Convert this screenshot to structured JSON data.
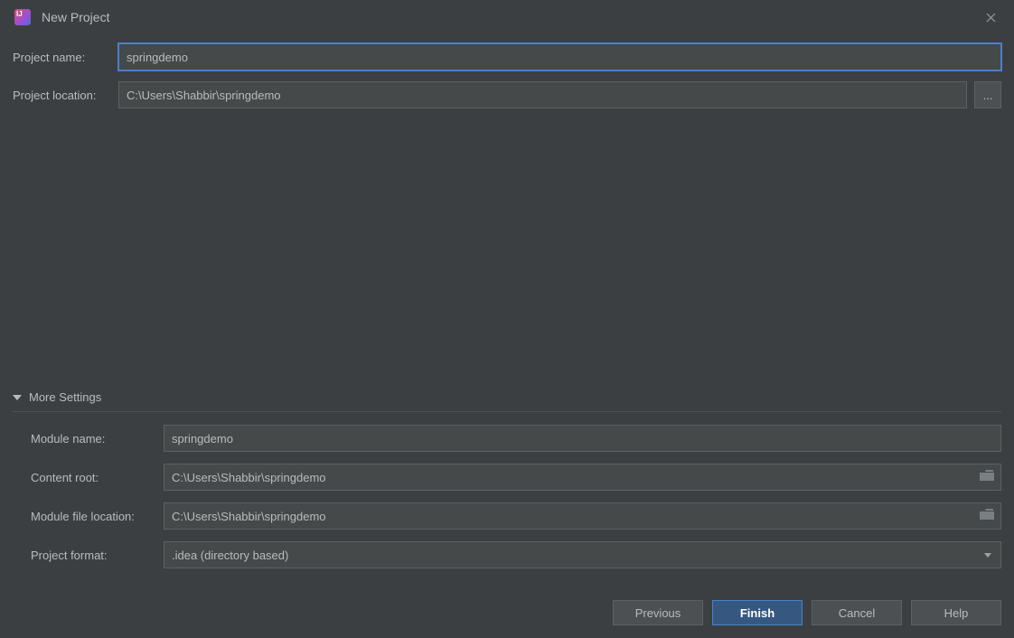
{
  "title": "New Project",
  "labels": {
    "projectName": "Project name:",
    "projectLocation": "Project location:",
    "moreSettings": "More Settings",
    "moduleName": "Module name:",
    "contentRoot": "Content root:",
    "moduleFileLocation": "Module file location:",
    "projectFormat": "Project format:"
  },
  "values": {
    "projectName": "springdemo",
    "projectLocation": "C:\\Users\\Shabbir\\springdemo",
    "moduleName": "springdemo",
    "contentRoot": "C:\\Users\\Shabbir\\springdemo",
    "moduleFileLocation": "C:\\Users\\Shabbir\\springdemo",
    "projectFormat": ".idea (directory based)"
  },
  "buttons": {
    "browse": "...",
    "previous": "Previous",
    "finish": "Finish",
    "cancel": "Cancel",
    "help": "Help"
  }
}
